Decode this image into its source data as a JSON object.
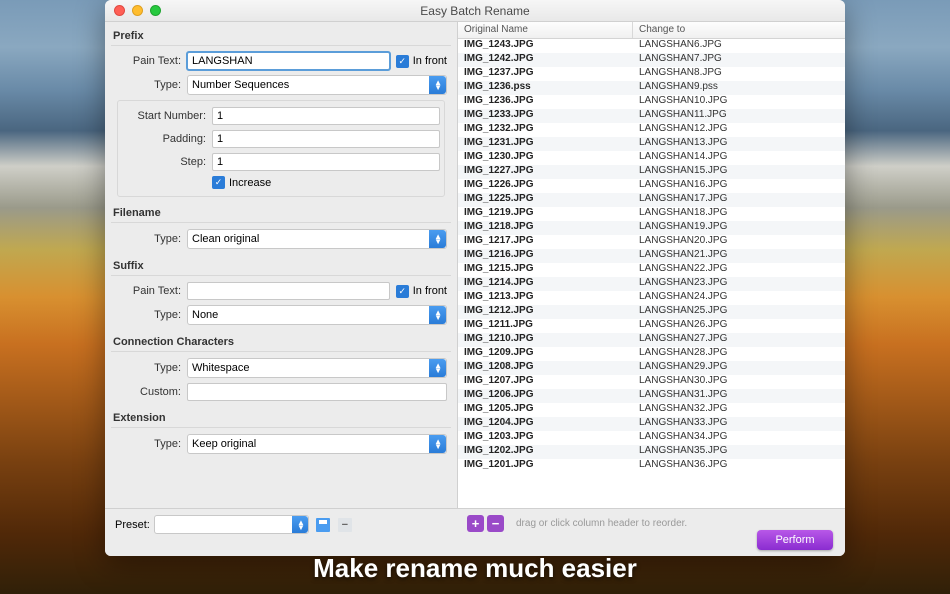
{
  "window_title": "Easy Batch Rename",
  "caption": "Make rename much easier",
  "prefix": {
    "heading": "Prefix",
    "pain_text_label": "Pain Text:",
    "pain_text_value": "LANGSHAN",
    "in_front_label": "In front",
    "type_label": "Type:",
    "type_value": "Number Sequences",
    "start_number_label": "Start Number:",
    "start_number_value": "1",
    "padding_label": "Padding:",
    "padding_value": "1",
    "step_label": "Step:",
    "step_value": "1",
    "increase_label": "Increase"
  },
  "filename": {
    "heading": "Filename",
    "type_label": "Type:",
    "type_value": "Clean original"
  },
  "suffix": {
    "heading": "Suffix",
    "pain_text_label": "Pain Text:",
    "pain_text_value": "",
    "in_front_label": "In front",
    "type_label": "Type:",
    "type_value": "None"
  },
  "connection": {
    "heading": "Connection Characters",
    "type_label": "Type:",
    "type_value": "Whitespace",
    "custom_label": "Custom:",
    "custom_value": ""
  },
  "extension": {
    "heading": "Extension",
    "type_label": "Type:",
    "type_value": "Keep original"
  },
  "preset_label": "Preset:",
  "right_columns": {
    "original": "Original Name",
    "change": "Change to"
  },
  "footer_hint": "drag or click column header to reorder.",
  "perform_label": "Perform",
  "files": [
    {
      "o": "IMG_1243.JPG",
      "n": "LANGSHAN6.JPG"
    },
    {
      "o": "IMG_1242.JPG",
      "n": "LANGSHAN7.JPG"
    },
    {
      "o": "IMG_1237.JPG",
      "n": "LANGSHAN8.JPG"
    },
    {
      "o": "IMG_1236.pss",
      "n": "LANGSHAN9.pss"
    },
    {
      "o": "IMG_1236.JPG",
      "n": "LANGSHAN10.JPG"
    },
    {
      "o": "IMG_1233.JPG",
      "n": "LANGSHAN11.JPG"
    },
    {
      "o": "IMG_1232.JPG",
      "n": "LANGSHAN12.JPG"
    },
    {
      "o": "IMG_1231.JPG",
      "n": "LANGSHAN13.JPG"
    },
    {
      "o": "IMG_1230.JPG",
      "n": "LANGSHAN14.JPG"
    },
    {
      "o": "IMG_1227.JPG",
      "n": "LANGSHAN15.JPG"
    },
    {
      "o": "IMG_1226.JPG",
      "n": "LANGSHAN16.JPG"
    },
    {
      "o": "IMG_1225.JPG",
      "n": "LANGSHAN17.JPG"
    },
    {
      "o": "IMG_1219.JPG",
      "n": "LANGSHAN18.JPG"
    },
    {
      "o": "IMG_1218.JPG",
      "n": "LANGSHAN19.JPG"
    },
    {
      "o": "IMG_1217.JPG",
      "n": "LANGSHAN20.JPG"
    },
    {
      "o": "IMG_1216.JPG",
      "n": "LANGSHAN21.JPG"
    },
    {
      "o": "IMG_1215.JPG",
      "n": "LANGSHAN22.JPG"
    },
    {
      "o": "IMG_1214.JPG",
      "n": "LANGSHAN23.JPG"
    },
    {
      "o": "IMG_1213.JPG",
      "n": "LANGSHAN24.JPG"
    },
    {
      "o": "IMG_1212.JPG",
      "n": "LANGSHAN25.JPG"
    },
    {
      "o": "IMG_1211.JPG",
      "n": "LANGSHAN26.JPG"
    },
    {
      "o": "IMG_1210.JPG",
      "n": "LANGSHAN27.JPG"
    },
    {
      "o": "IMG_1209.JPG",
      "n": "LANGSHAN28.JPG"
    },
    {
      "o": "IMG_1208.JPG",
      "n": "LANGSHAN29.JPG"
    },
    {
      "o": "IMG_1207.JPG",
      "n": "LANGSHAN30.JPG"
    },
    {
      "o": "IMG_1206.JPG",
      "n": "LANGSHAN31.JPG"
    },
    {
      "o": "IMG_1205.JPG",
      "n": "LANGSHAN32.JPG"
    },
    {
      "o": "IMG_1204.JPG",
      "n": "LANGSHAN33.JPG"
    },
    {
      "o": "IMG_1203.JPG",
      "n": "LANGSHAN34.JPG"
    },
    {
      "o": "IMG_1202.JPG",
      "n": "LANGSHAN35.JPG"
    },
    {
      "o": "IMG_1201.JPG",
      "n": "LANGSHAN36.JPG"
    }
  ]
}
